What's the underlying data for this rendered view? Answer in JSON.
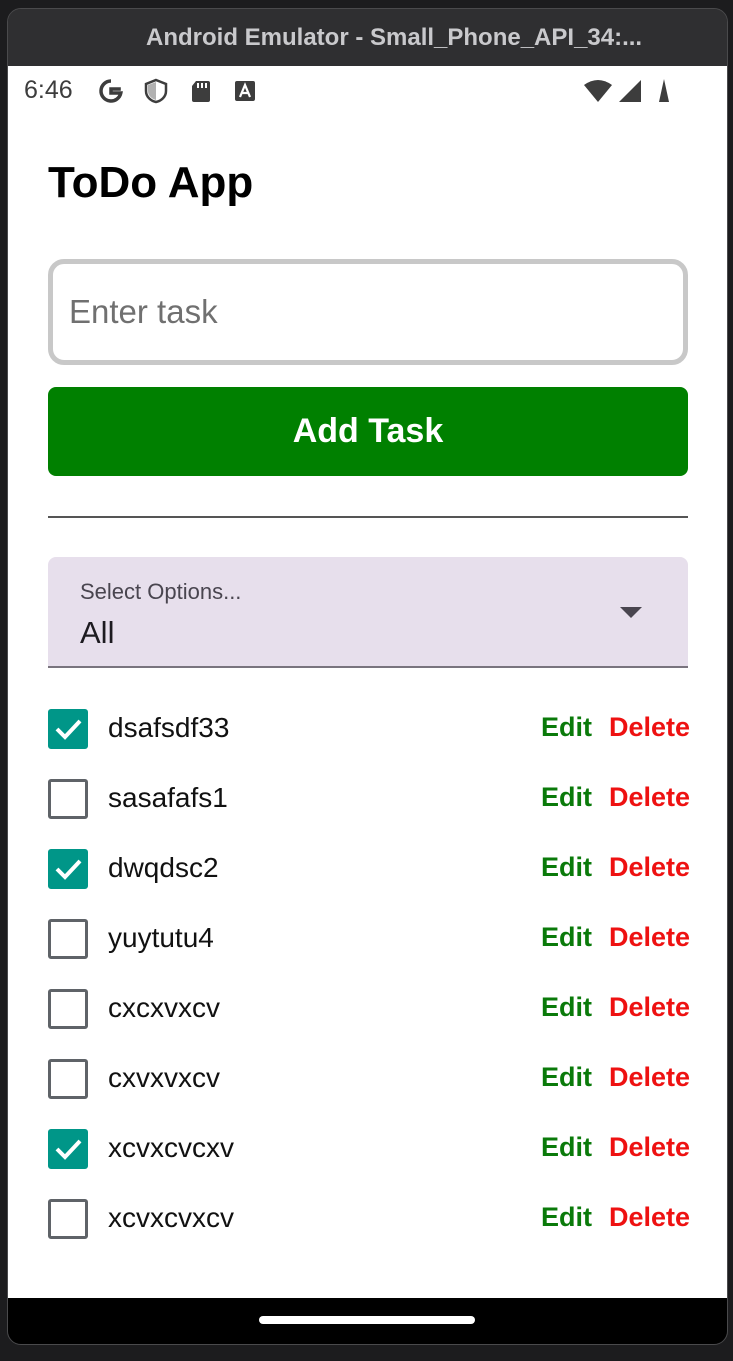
{
  "window": {
    "title": "Android Emulator - Small_Phone_API_34:..."
  },
  "status_bar": {
    "time": "6:46",
    "left_icons": [
      "google-icon",
      "shield-icon",
      "sd-card-icon",
      "text-icon"
    ],
    "right_icons": [
      "wifi-icon",
      "cell-signal-icon",
      "battery-icon"
    ]
  },
  "app": {
    "title": "ToDo App",
    "input": {
      "placeholder": "Enter task",
      "value": ""
    },
    "add_button_label": "Add Task",
    "filter": {
      "label": "Select Options...",
      "value": "All"
    },
    "colors": {
      "add_button": "#008000",
      "edit": "#0a7a0a",
      "delete": "#ee1111",
      "checkbox_checked": "#009688",
      "select_background": "#e7dfec"
    },
    "tasks": [
      {
        "text": "dsafsdf33",
        "done": true,
        "edit_label": "Edit",
        "delete_label": "Delete"
      },
      {
        "text": "sasafafs1",
        "done": false,
        "edit_label": "Edit",
        "delete_label": "Delete"
      },
      {
        "text": "dwqdsc2",
        "done": true,
        "edit_label": "Edit",
        "delete_label": "Delete"
      },
      {
        "text": "yuytutu4",
        "done": false,
        "edit_label": "Edit",
        "delete_label": "Delete"
      },
      {
        "text": "cxcxvxcv",
        "done": false,
        "edit_label": "Edit",
        "delete_label": "Delete"
      },
      {
        "text": "cxvxvxcv",
        "done": false,
        "edit_label": "Edit",
        "delete_label": "Delete"
      },
      {
        "text": "xcvxcvcxv",
        "done": true,
        "edit_label": "Edit",
        "delete_label": "Delete"
      },
      {
        "text": "xcvxcvxcv",
        "done": false,
        "edit_label": "Edit",
        "delete_label": "Delete"
      }
    ]
  }
}
